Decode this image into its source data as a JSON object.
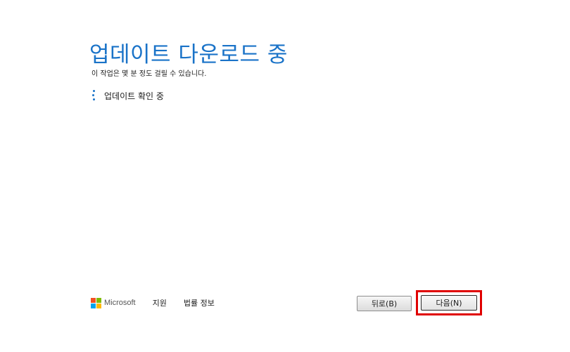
{
  "header": {
    "title": "업데이트 다운로드 중",
    "subtitle": "이 작업은 몇 분 정도 걸릴 수 있습니다."
  },
  "status": {
    "text": "업데이트 확인 중",
    "spinner_icon": "loading-dots-icon"
  },
  "footer": {
    "brand": "Microsoft",
    "logo_colors": [
      "#f25022",
      "#7fba00",
      "#00a4ef",
      "#ffb900"
    ],
    "links": {
      "support": "지원",
      "legal": "법률 정보"
    }
  },
  "buttons": {
    "back": "뒤로(B)",
    "next": "다음(N)"
  },
  "colors": {
    "accent": "#1a73c8",
    "highlight": "#e00000"
  }
}
